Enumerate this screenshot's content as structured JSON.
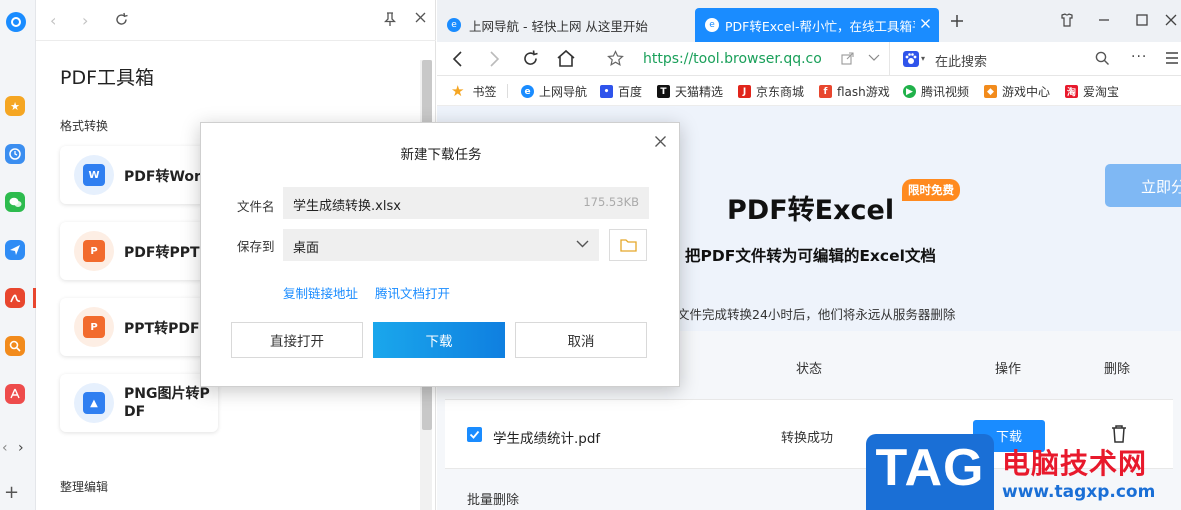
{
  "panel": {
    "title": "PDF工具箱",
    "section1": "格式转换",
    "section2": "整理编辑",
    "tools": [
      {
        "label": "PDF转Word",
        "icon": "pdf-to-word-icon"
      },
      {
        "label": "PDF转PPT",
        "icon": "pdf-to-ppt-icon"
      },
      {
        "label": "PPT转PDF",
        "icon": "ppt-to-pdf-icon"
      },
      {
        "label": "PNG图片转PDF",
        "icon": "png-to-pdf-icon"
      }
    ]
  },
  "tabs": [
    {
      "label": "上网导航 - 轻快上网 从这里开始",
      "active": false
    },
    {
      "label": "PDF转Excel-帮小忙，在线工具箱平台",
      "active": true
    }
  ],
  "address": {
    "url": "https://tool.browser.qq.com",
    "search_placeholder": "在此搜索"
  },
  "bookmarks": [
    "书签",
    "上网导航",
    "百度",
    "天猫精选",
    "京东商城",
    "flash游戏",
    "腾讯视频",
    "游戏中心",
    "爱淘宝"
  ],
  "page": {
    "title": "PDF转Excel",
    "badge": "限时免费",
    "subtitle": "把PDF文件转为可编辑的Excel文档",
    "notice": "文件完成转换24小时后，他们将永远从服务器删除",
    "cta": "立即分",
    "col_status": "状态",
    "col_action": "操作",
    "col_delete": "删除",
    "file_name": "学生成绩统计.pdf",
    "file_status": "转换成功",
    "file_action": "下载",
    "bulk_delete": "批量删除"
  },
  "dialog": {
    "title": "新建下载任务",
    "filename_label": "文件名",
    "filename_value": "学生成绩转换.xlsx",
    "filesize": "175.53KB",
    "saveto_label": "保存到",
    "saveto_value": "桌面",
    "link_copy": "复制链接地址",
    "link_open": "腾讯文档打开",
    "btn_open": "直接打开",
    "btn_download": "下载",
    "btn_cancel": "取消"
  },
  "watermark": {
    "tag": "TAG",
    "cn": "电脑技术网",
    "url": "www.tagxp.com"
  },
  "colors": {
    "accent": "#1a8cff",
    "download_btn": "#1296db",
    "badge": "#ff8a1f",
    "tag_blue": "#1a6fd6",
    "watermark_red": "#e8192c"
  }
}
